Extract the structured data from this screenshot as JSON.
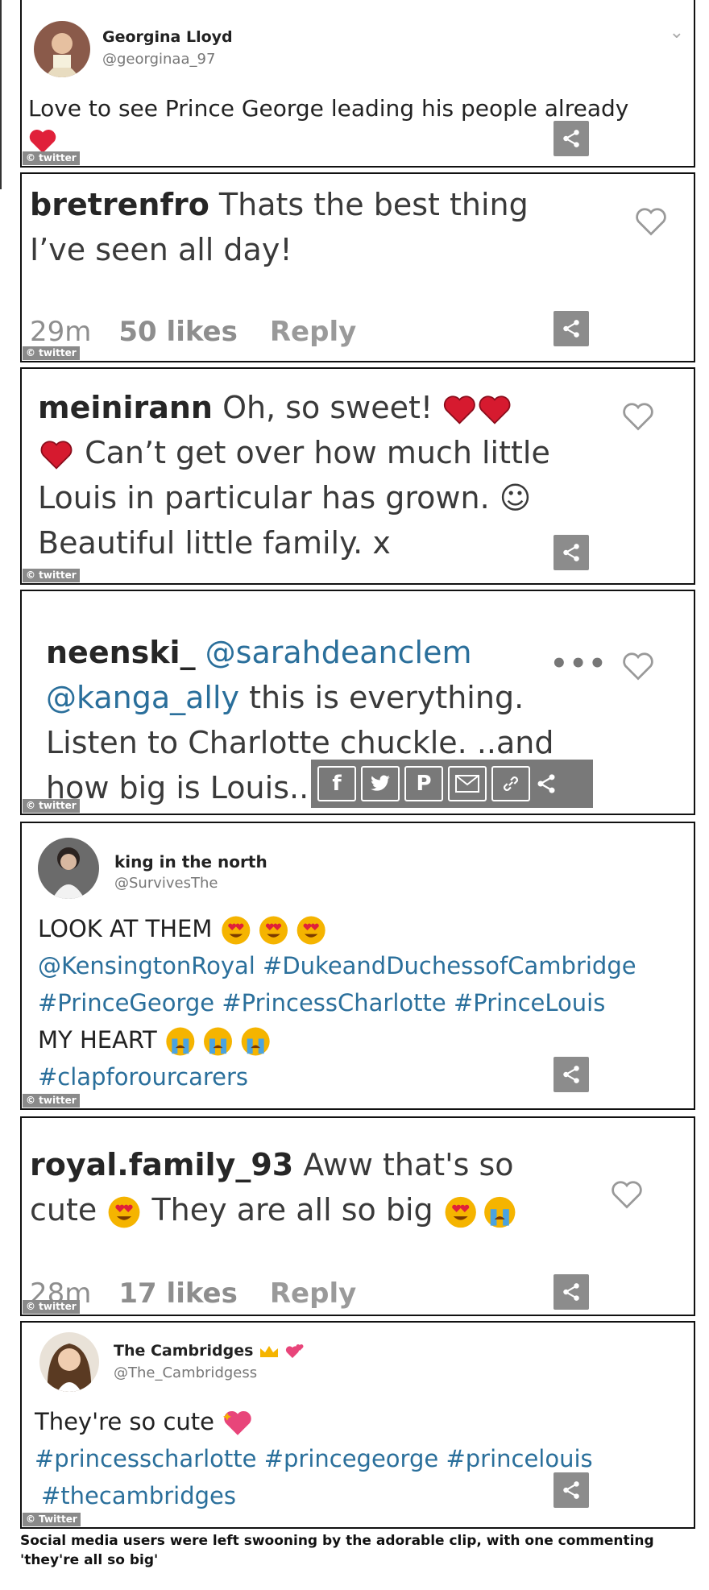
{
  "cards": {
    "c1": {
      "name": "Georgina Lloyd",
      "handle": "@georginaa_97",
      "text": "Love to see Prince George leading his people already",
      "badge": "© twitter"
    },
    "c2": {
      "user": "bretrenfro",
      "text1": "Thats the best thing",
      "text2": "I’ve seen all day!",
      "time": "29m",
      "likes": "50 likes",
      "reply": "Reply",
      "badge": "© twitter"
    },
    "c3": {
      "user": "meinirann",
      "line1": "Oh, so sweet!",
      "line2": "Can’t get over how much little",
      "line3": "Louis in particular has grown. ☺",
      "line4": "Beautiful little family. x",
      "badge": "© twitter"
    },
    "c4": {
      "user": "neenski_",
      "mention1": "@sarahdeanclem",
      "mention2": "@kanga_ally",
      "line2rest": "this is everything.",
      "line3": "Listen to Charlotte chuckle. ..and",
      "line4": "how big is Louis..",
      "dots": "•••",
      "badge": "© twitter"
    },
    "c5": {
      "name": "king in the north",
      "handle": "@SurvivesThe",
      "line1": "LOOK AT THEM",
      "line2a": "@KensingtonRoyal",
      "line2b": "#DukeandDuchessofCambridge",
      "line3a": "#PrinceGeorge",
      "line3b": "#PrincessCharlotte",
      "line3c": "#PrinceLouis",
      "line4": "MY HEART",
      "line5": "#clapforourcarers",
      "badge": "© twitter"
    },
    "c6": {
      "user": "royal.family_93",
      "text1": "Aww that's so",
      "text2a": "cute",
      "text2b": "They are all so big",
      "time": "28m",
      "likes": "17 likes",
      "reply": "Reply",
      "badge": "© twitter"
    },
    "c7": {
      "name": "The Cambridges",
      "handle": "@The_Cambridgess",
      "line1": "They're so cute",
      "line2a": "#princesscharlotte",
      "line2b": "#princegeorge",
      "line2c": "#princelouis",
      "line3": "#thecambridges",
      "badge": "© Twitter"
    }
  },
  "share_bar": {
    "icons": [
      "facebook-icon",
      "twitter-icon",
      "pinterest-icon",
      "email-icon",
      "link-icon"
    ]
  },
  "caption": "Social media users were left swooning by the adorable clip, with one commenting 'they're all so big'",
  "colors": {
    "link": "#2a6f9b",
    "share": "#8c8c8c",
    "heart": "#e0203a"
  }
}
